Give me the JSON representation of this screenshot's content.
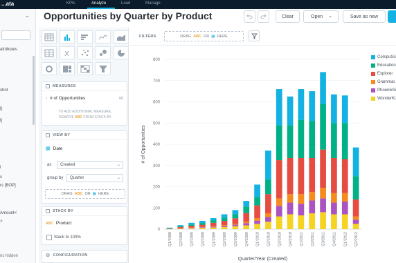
{
  "topbar": {
    "logo": "...ata",
    "tabs": [
      {
        "label": "KPIs",
        "active": false
      },
      {
        "label": "Analyze",
        "active": true
      },
      {
        "label": "Load",
        "active": false
      },
      {
        "label": "Manage",
        "active": false
      }
    ]
  },
  "left_panel": {
    "items": [
      "attributes",
      "shot",
      "l]",
      "l]",
      "l",
      "s",
      "rs [BOP]",
      "Amount<",
      ">",
      "ns hidden"
    ]
  },
  "header": {
    "title": "Opportunities by Quarter by Product",
    "undo_icon": "undo-icon",
    "redo_icon": "redo-icon",
    "clear_label": "Clear",
    "open_label": "Open",
    "save_as_new_label": "Save as new"
  },
  "viz_types": [
    "table-icon",
    "column-chart-icon",
    "bar-chart-icon",
    "line-chart-icon",
    "area-chart-icon",
    "headline-icon",
    "scatter-icon",
    "bubble-icon",
    "pie-chart-icon",
    "donut-icon",
    "treemap-icon",
    "heatmap-icon",
    "funnel-icon"
  ],
  "measures": {
    "header": "MEASURES",
    "item": "# of Opportunities",
    "item_suffix": "M1",
    "hint_pre": "TO ADD ADDITIONAL MEASURE,",
    "hint_remove": "REMOVE",
    "hint_abc": "ABC",
    "hint_post": "FROM STACK BY"
  },
  "view_by": {
    "header": "VIEW BY",
    "item": "Date",
    "as_label": "as",
    "as_value": "Created",
    "group_label": "group by",
    "group_value": "Quarter",
    "drop_text_pre": "DRAG",
    "drop_abc": "ABC",
    "drop_mid": "OR",
    "drop_post": "HERE"
  },
  "stack_by": {
    "header": "STACK BY",
    "item": "Product",
    "item_abc": "ABC",
    "checkbox_label": "Stack to 100%"
  },
  "configuration": {
    "header": "CONFIGURATION"
  },
  "filters": {
    "label": "FILTERS",
    "drop_pre": "DRAG",
    "drop_abc": "ABC",
    "drop_mid": "OR",
    "drop_post": "HERE"
  },
  "chart_data": {
    "type": "bar",
    "stacked": true,
    "ylabel": "# of Opportunities",
    "xlabel": "Quarter/Year (Created)",
    "ylim": [
      0,
      800
    ],
    "yticks": [
      0,
      100,
      200,
      300,
      400,
      500,
      600,
      700,
      800
    ],
    "grid": true,
    "legend_position": "right",
    "categories": [
      "Q1/2008",
      "Q2/2008",
      "Q3/2008",
      "Q4/2008",
      "Q1/2009",
      "Q2/2009",
      "Q3/2009",
      "Q4/2009",
      "Q1/2010",
      "Q2/2010",
      "Q3/2010",
      "Q4/2010",
      "Q1/2011",
      "Q2/2011",
      "Q3/2011",
      "Q4/2011",
      "Q1/2012",
      "Q2/2012"
    ],
    "series": [
      {
        "name": "WonderKi...",
        "color": "#f5d322",
        "values": [
          1,
          3,
          4,
          6,
          8,
          10,
          14,
          18,
          25,
          35,
          60,
          70,
          65,
          75,
          80,
          70,
          70,
          25
        ]
      },
      {
        "name": "PhoenixSo...",
        "color": "#ab53c0",
        "values": [
          0,
          1,
          2,
          3,
          4,
          5,
          7,
          10,
          15,
          22,
          50,
          55,
          55,
          60,
          65,
          55,
          60,
          20
        ]
      },
      {
        "name": "Grammar...",
        "color": "#f58a1f",
        "values": [
          0,
          1,
          2,
          2,
          3,
          4,
          5,
          8,
          12,
          18,
          35,
          40,
          45,
          40,
          50,
          45,
          40,
          15
        ]
      },
      {
        "name": "Explorer",
        "color": "#e54d42",
        "values": [
          2,
          5,
          8,
          10,
          15,
          20,
          25,
          40,
          60,
          90,
          180,
          170,
          170,
          160,
          180,
          165,
          160,
          80
        ]
      },
      {
        "name": "Education...",
        "color": "#00b087",
        "values": [
          2,
          4,
          6,
          8,
          12,
          15,
          20,
          30,
          40,
          70,
          165,
          155,
          180,
          175,
          215,
          165,
          170,
          110
        ]
      },
      {
        "name": "CompuSci...",
        "color": "#14b2e2",
        "values": [
          2,
          5,
          8,
          10,
          10,
          16,
          19,
          27,
          58,
          135,
          170,
          135,
          145,
          140,
          150,
          135,
          130,
          135
        ]
      }
    ]
  }
}
